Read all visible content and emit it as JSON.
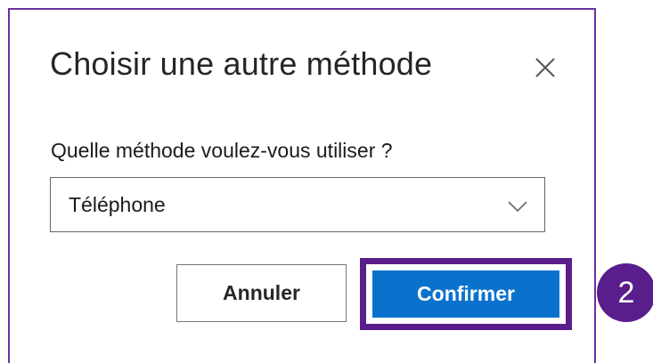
{
  "dialog": {
    "title": "Choisir une autre méthode",
    "question": "Quelle méthode voulez-vous utiliser ?",
    "method_select": {
      "selected": "Téléphone"
    },
    "buttons": {
      "cancel": "Annuler",
      "confirm": "Confirmer"
    }
  },
  "annotation": {
    "step_number": "2"
  },
  "colors": {
    "primary_button": "#0a72cc",
    "highlight": "#5a1d8c",
    "dialog_border": "#6b2fa0"
  },
  "icons": {
    "close": "close-icon",
    "dropdown": "chevron-down-icon"
  }
}
